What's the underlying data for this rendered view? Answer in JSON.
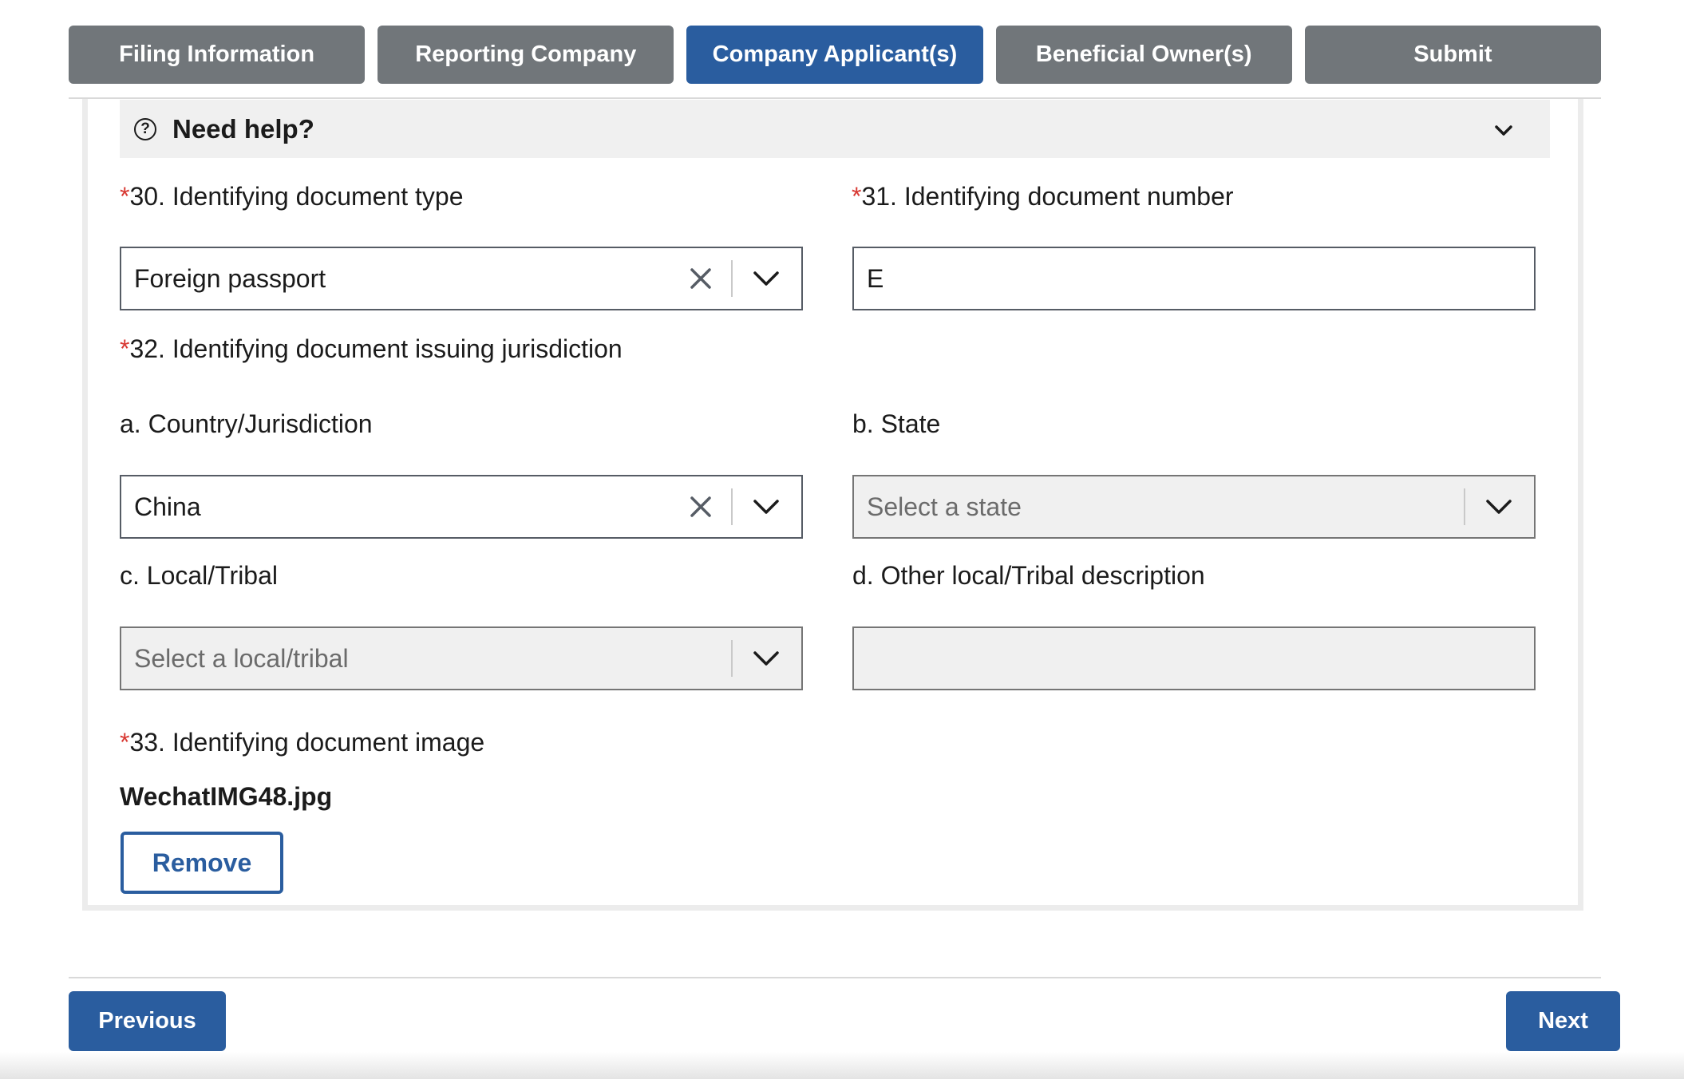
{
  "tabs": [
    {
      "label": "Filing Information",
      "active": false
    },
    {
      "label": "Reporting Company",
      "active": false
    },
    {
      "label": "Company Applicant(s)",
      "active": true
    },
    {
      "label": "Beneficial Owner(s)",
      "active": false
    },
    {
      "label": "Submit",
      "active": false
    }
  ],
  "help": {
    "label": "Need help?",
    "icon": "question-circle-icon",
    "toggle_icon": "chevron-down-icon"
  },
  "required_marker": "*",
  "fields": {
    "doc_type": {
      "label": "30. Identifying document type",
      "value": "Foreign passport",
      "required": true
    },
    "doc_number": {
      "label": "31. Identifying document number",
      "value": "E",
      "required": true
    },
    "jurisdiction": {
      "label": "32. Identifying document issuing jurisdiction",
      "required": true
    },
    "country": {
      "label": "a. Country/Jurisdiction",
      "value": "China"
    },
    "state": {
      "label": "b. State",
      "placeholder": "Select a state",
      "disabled": true
    },
    "local_tribal": {
      "label": "c. Local/Tribal",
      "placeholder": "Select a local/tribal",
      "disabled": true
    },
    "other_local": {
      "label": "d. Other local/Tribal description",
      "value": "",
      "disabled": true
    },
    "doc_image": {
      "label": "33. Identifying document image",
      "filename": "WechatIMG48.jpg",
      "remove_label": "Remove",
      "required": true
    }
  },
  "nav": {
    "previous_label": "Previous",
    "next_label": "Next"
  },
  "colors": {
    "primary": "#2a5d9f",
    "tab_inactive": "#71767a",
    "required": "#d83933",
    "disabled_bg": "#f0f0f0"
  }
}
